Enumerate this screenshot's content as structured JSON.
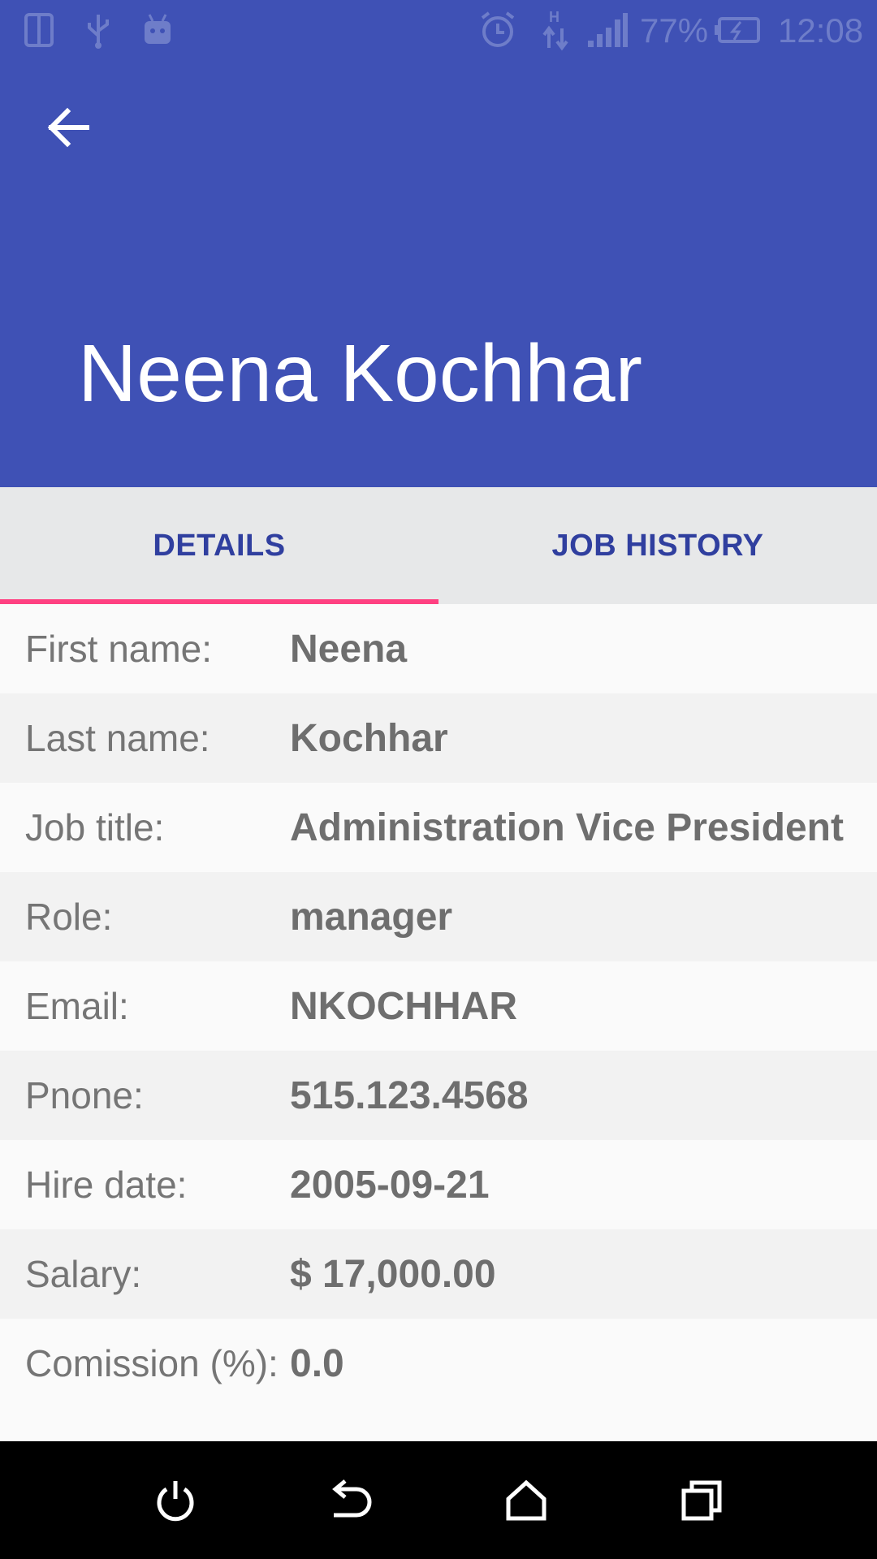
{
  "status_bar": {
    "battery_percent": "77%",
    "time": "12:08",
    "network_type": "H",
    "icons": [
      "phone-icon",
      "usb-icon",
      "android-icon",
      "alarm-icon",
      "data-arrows-icon",
      "signal-icon",
      "battery-charging-icon"
    ]
  },
  "app_bar": {
    "back_icon": "arrow-back-icon",
    "title": "Neena Kochhar"
  },
  "tabs": [
    {
      "label": "DETAILS",
      "active": true
    },
    {
      "label": "JOB HISTORY",
      "active": false
    }
  ],
  "details": [
    {
      "label": "First name:",
      "value": "Neena"
    },
    {
      "label": "Last name:",
      "value": "Kochhar"
    },
    {
      "label": "Job title:",
      "value": "Administration Vice President"
    },
    {
      "label": "Role:",
      "value": "manager"
    },
    {
      "label": "Email:",
      "value": "NKOCHHAR"
    },
    {
      "label": "Pnone:",
      "value": "515.123.4568"
    },
    {
      "label": "Hire date:",
      "value": "2005-09-21"
    },
    {
      "label": "Salary:",
      "value": "$ 17,000.00"
    },
    {
      "label": "Comission (%):",
      "value": "0.0"
    }
  ],
  "nav_bar": {
    "icons": [
      "power-icon",
      "back-icon",
      "home-icon",
      "recents-icon"
    ]
  },
  "colors": {
    "primary": "#3f51b5",
    "accent": "#ff4081",
    "tab_text": "#303f9f"
  }
}
